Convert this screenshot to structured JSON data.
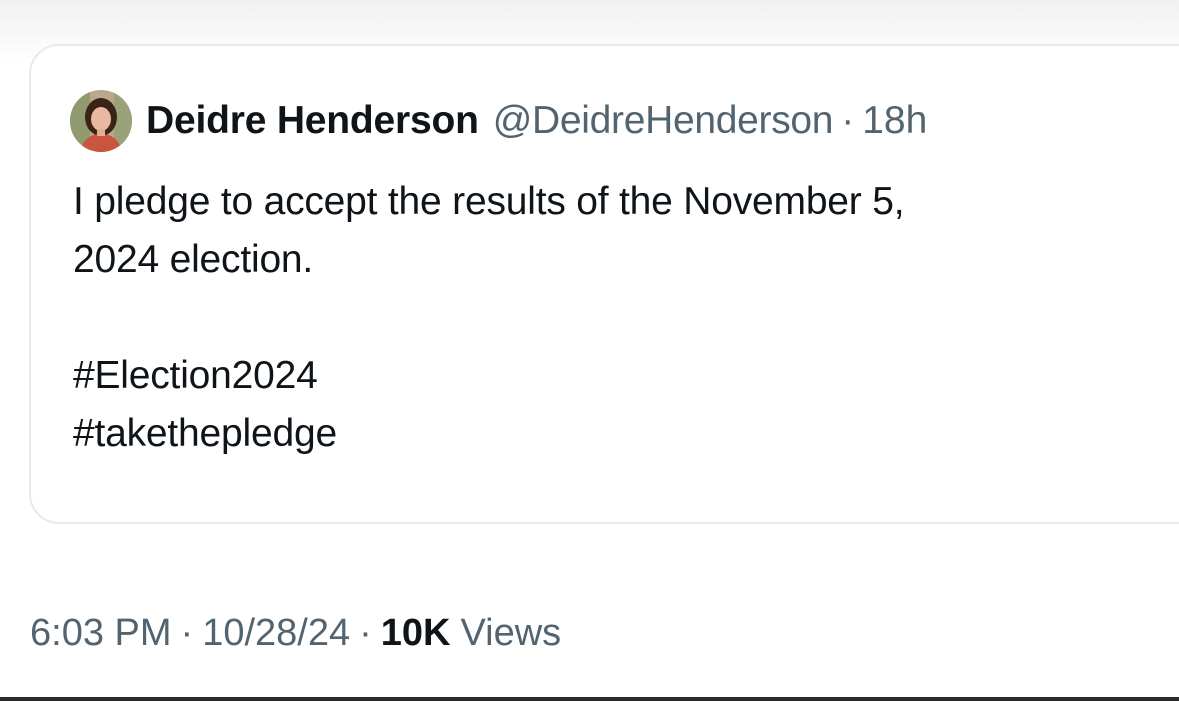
{
  "quoted_tweet": {
    "author": {
      "display_name": "Deidre Henderson",
      "handle": "@DeidreHenderson",
      "avatar_icon": "profile-photo-avatar"
    },
    "separator": "·",
    "time_ago": "18h",
    "text_lines": [
      "I pledge to accept the results of the November 5,",
      "2024 election."
    ],
    "hashtags": [
      "#Election2024",
      "#takethepledge"
    ]
  },
  "post_meta": {
    "time": "6:03 PM",
    "date": "10/28/24",
    "separator": "·",
    "views_count": "10K",
    "views_label": "Views"
  },
  "colors": {
    "primary_text": "#0f1419",
    "secondary_text": "#536471",
    "card_border": "#e7e9ec"
  }
}
